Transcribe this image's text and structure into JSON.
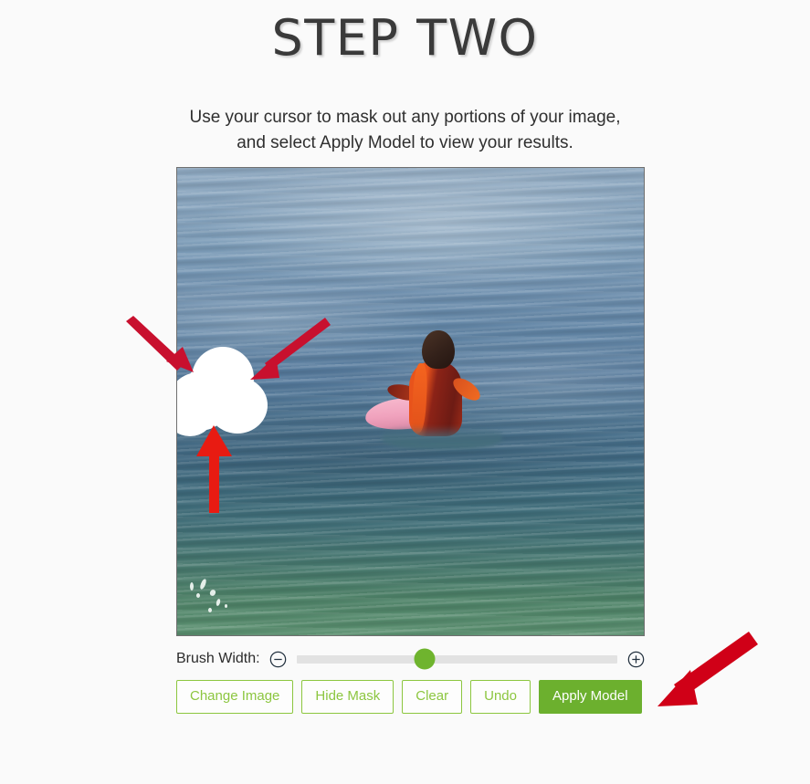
{
  "header": {
    "title": "STEP TWO",
    "instruction_line_1": "Use your cursor to mask out any portions of your image,",
    "instruction_line_2": "and select Apply Model to view your results."
  },
  "editor": {
    "canvas": {
      "name": "mask-editing-canvas",
      "image_subject": "surfer on a pink surfboard in the ocean",
      "mask_color": "#ffffff",
      "has_painted_mask": true
    },
    "annotations": [
      {
        "name": "arrow-to-mask-left",
        "color": "#c8102e",
        "direction": "down-right"
      },
      {
        "name": "arrow-to-mask-right",
        "color": "#c8102e",
        "direction": "down-left"
      },
      {
        "name": "arrow-to-mask-bottom",
        "color": "#e81b12",
        "direction": "up"
      },
      {
        "name": "arrow-to-apply-model",
        "color": "#d00017",
        "direction": "down-left"
      }
    ]
  },
  "brush": {
    "label": "Brush Width:",
    "decrease_icon": "minus-circle-icon",
    "increase_icon": "plus-circle-icon",
    "value_percent": 40,
    "thumb_color": "#6fb42e",
    "track_color": "#e2e2e2"
  },
  "buttons": [
    {
      "name": "change-image-button",
      "label": "Change Image",
      "primary": false
    },
    {
      "name": "hide-mask-button",
      "label": "Hide Mask",
      "primary": false
    },
    {
      "name": "clear-button",
      "label": "Clear",
      "primary": false
    },
    {
      "name": "undo-button",
      "label": "Undo",
      "primary": false
    },
    {
      "name": "apply-model-button",
      "label": "Apply Model",
      "primary": true
    }
  ],
  "colors": {
    "page_background": "#fafafa",
    "accent_green": "#8cc63f",
    "accent_green_solid": "#6cb02e",
    "annotation_red": "#c8102e",
    "title_text": "#3a3a3a"
  }
}
